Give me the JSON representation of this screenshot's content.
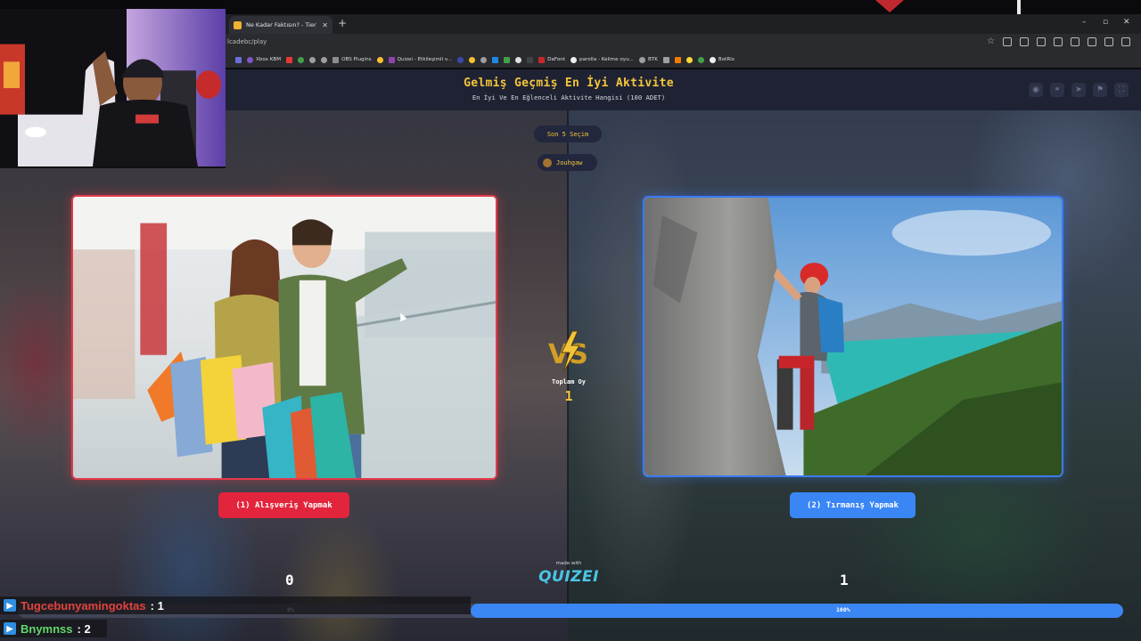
{
  "browser": {
    "tab_title": "Ne Kadar Faktısın? - Tier List | K",
    "url_fragment": "lcadebc/play",
    "bookmarks": [
      "Xbox KBM",
      "OBS Plugins",
      "Quizei - Etkileşimli v...",
      "DaFont",
      "parolla - Kelime oyu...",
      "BTK",
      "BotRix"
    ]
  },
  "header": {
    "title": "Gelmiş Geçmiş En İyi Aktivite",
    "subtitle": "En İyi Ve En Eğlenceli Aktivite Hangisi (100 ADET)"
  },
  "recent": {
    "label": "Son 5 Seçim",
    "user": "Jouhgaw"
  },
  "options": {
    "left": {
      "label": "(1) Alışveriş Yapmak",
      "score": "0",
      "percent_label": "0%"
    },
    "right": {
      "label": "(2) Tırmanış Yapmak",
      "score": "1",
      "percent_label": "100%"
    }
  },
  "center": {
    "vs_text": "VS",
    "total_label": "Toplam Oy",
    "total_value": "1"
  },
  "footer": {
    "made_with": "made with",
    "brand": "QUIZEI"
  },
  "progress": {
    "right_share": 1.0
  },
  "chat": [
    {
      "user": "Tugcebunyamingoktas",
      "value": ": 1"
    },
    {
      "user": "Bnymnss",
      "value": ": 2"
    }
  ],
  "colors": {
    "accent_gold": "#f3c53b",
    "left_red": "#e2243c",
    "right_blue": "#3b86f5",
    "brand_cyan": "#49c6e5"
  }
}
